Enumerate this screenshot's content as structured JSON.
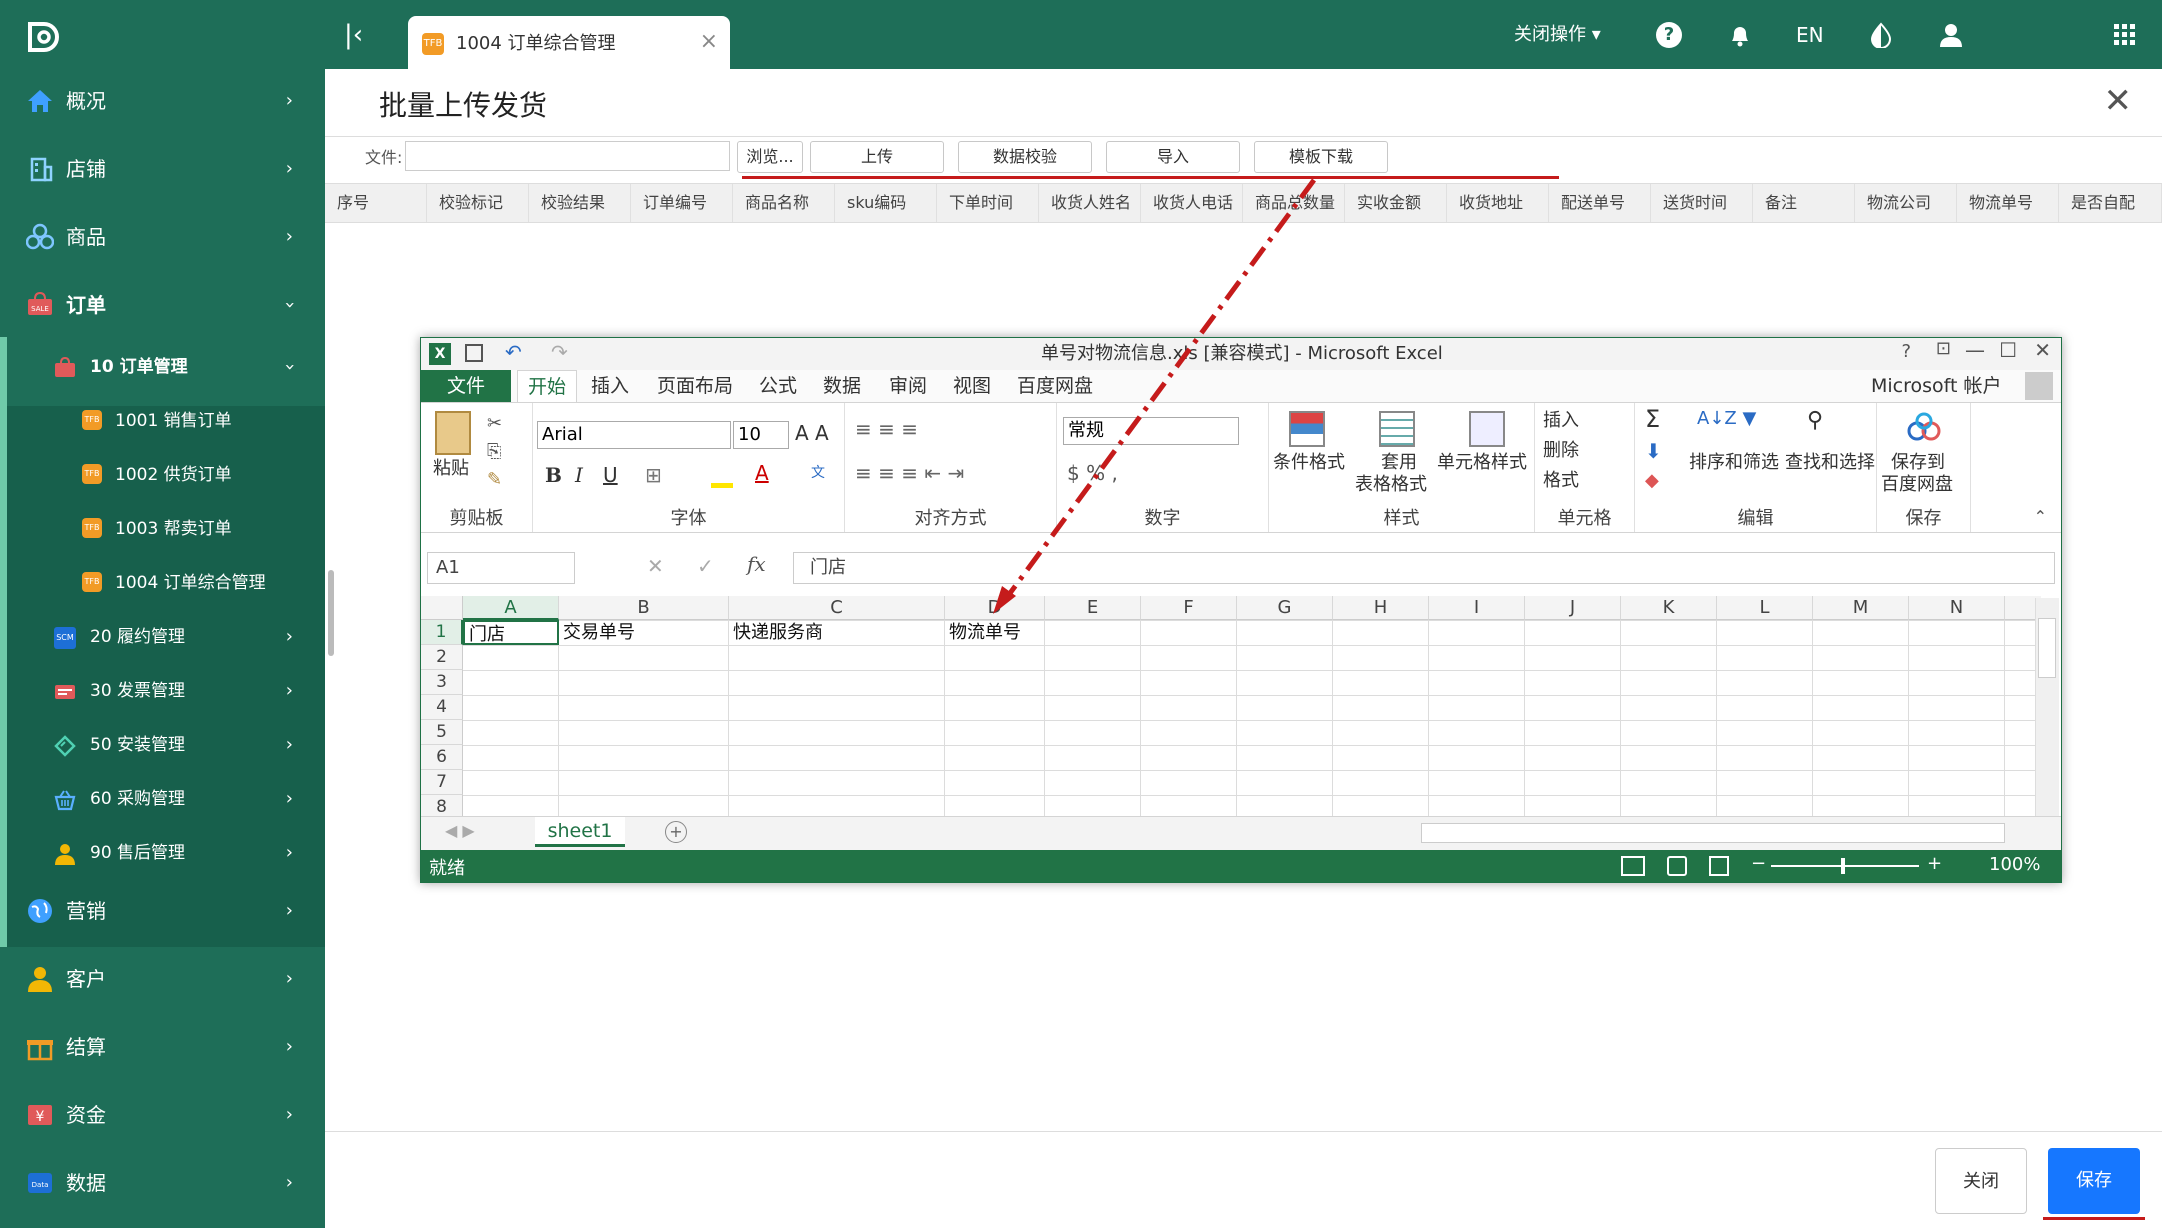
{
  "topbar": {
    "tab_label": "1004 订单综合管理",
    "tab_icon": "TFB",
    "close_ops": "关闭操作",
    "help": "?",
    "lang": "EN"
  },
  "sidebar": {
    "items": [
      {
        "label": "概况",
        "icon": "home-icon"
      },
      {
        "label": "店铺",
        "icon": "building-icon"
      },
      {
        "label": "商品",
        "icon": "goods-icon"
      },
      {
        "label": "订单",
        "icon": "sale-icon"
      },
      {
        "label": "10 订单管理",
        "icon": "sale-icon"
      },
      {
        "label": "1001 销售订单",
        "icon": "TFB"
      },
      {
        "label": "1002 供货订单",
        "icon": "TFB"
      },
      {
        "label": "1003 帮卖订单",
        "icon": "TFB"
      },
      {
        "label": "1004 订单综合管理",
        "icon": "TFB"
      },
      {
        "label": "20 履约管理",
        "icon": "SCM"
      },
      {
        "label": "30 发票管理",
        "icon": "invoice-icon"
      },
      {
        "label": "50 安装管理",
        "icon": "install-icon"
      },
      {
        "label": "60 采购管理",
        "icon": "basket-icon"
      },
      {
        "label": "90 售后管理",
        "icon": "person-icon"
      },
      {
        "label": "营销",
        "icon": "globe-icon"
      },
      {
        "label": "客户",
        "icon": "customer-icon"
      },
      {
        "label": "结算",
        "icon": "gift-icon"
      },
      {
        "label": "资金",
        "icon": "money-icon"
      },
      {
        "label": "数据",
        "icon": "data-icon"
      }
    ]
  },
  "page": {
    "title": "批量上传发货",
    "file_label": "文件:",
    "buttons": {
      "browse": "浏览...",
      "upload": "上传",
      "validate": "数据校验",
      "import": "导入",
      "template": "模板下载"
    },
    "columns": [
      "序号",
      "校验标记",
      "校验结果",
      "订单编号",
      "商品名称",
      "sku编码",
      "下单时间",
      "收货人姓名",
      "收货人电话",
      "商品总数量",
      "实收金额",
      "收货地址",
      "配送单号",
      "送货时间",
      "备注",
      "物流公司",
      "物流单号",
      "是否自配"
    ],
    "close_btn": "关闭",
    "save_btn": "保存"
  },
  "excel": {
    "title": "单号对物流信息.xls [兼容模式] - Microsoft Excel",
    "menu": [
      "文件",
      "开始",
      "插入",
      "页面布局",
      "公式",
      "数据",
      "审阅",
      "视图",
      "百度网盘"
    ],
    "account": "Microsoft 帐户",
    "ribbon": {
      "paste": "粘贴",
      "clipboard": "剪贴板",
      "font_name": "Arial",
      "font_size": "10",
      "font_group": "字体",
      "align_group": "对齐方式",
      "number_format": "常规",
      "number_group": "数字",
      "cond_format": "条件格式",
      "table_format_1": "套用",
      "table_format_2": "表格格式",
      "cell_style": "单元格样式",
      "style_group": "样式",
      "insert": "插入",
      "delete": "删除",
      "format": "格式",
      "cells_group": "单元格",
      "sort_filter": "排序和筛选",
      "find_select": "查找和选择",
      "edit_group": "编辑",
      "save_baidu_1": "保存到",
      "save_baidu_2": "百度网盘",
      "save_group": "保存"
    },
    "namebox": "A1",
    "formula": "门店",
    "col_letters": [
      "A",
      "B",
      "C",
      "D",
      "E",
      "F",
      "G",
      "H",
      "I",
      "J",
      "K",
      "L",
      "M",
      "N"
    ],
    "rows": [
      "1",
      "2",
      "3",
      "4",
      "5",
      "6",
      "7",
      "8"
    ],
    "cells": {
      "A1": "门店",
      "B1": "交易单号",
      "C1": "快递服务商",
      "D1": "物流单号"
    },
    "sheet_tab": "sheet1",
    "status_ready": "就绪",
    "zoom": "100%"
  },
  "colors": {
    "brand": "#1e6e58",
    "excel": "#217346",
    "save": "#1677ff",
    "annotation": "#c51b1b"
  }
}
